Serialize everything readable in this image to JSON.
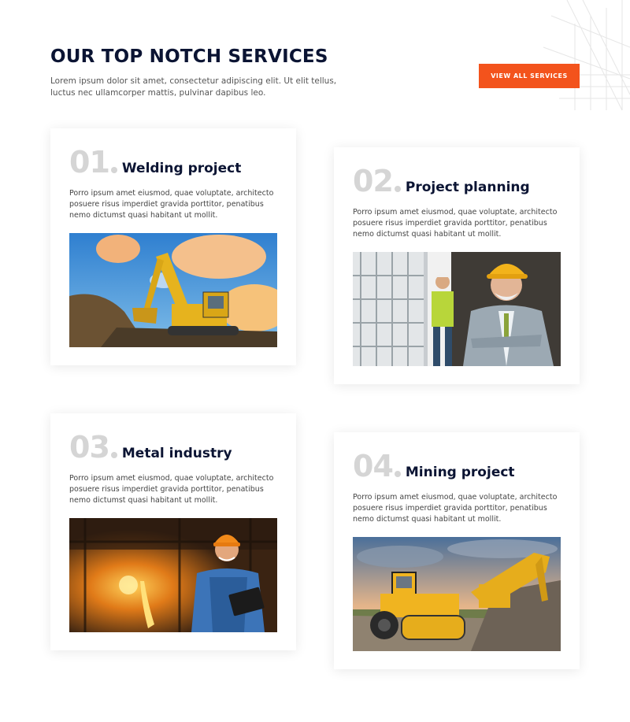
{
  "header": {
    "title": "OUR TOP NOTCH SERVICES",
    "intro": "Lorem ipsum dolor sit amet, consectetur adipiscing elit. Ut elit tellus, luctus nec ullamcorper mattis, pulvinar dapibus leo."
  },
  "actions": {
    "view_all_label": "VIEW ALL SERVICES"
  },
  "services": [
    {
      "number": "01",
      "title": "Welding project",
      "text": "Porro ipsum amet eiusmod, quae voluptate, architecto posuere risus imperdiet gravida porttitor, penatibus nemo dictumst quasi habitant ut mollit."
    },
    {
      "number": "02",
      "title": "Project planning",
      "text": "Porro ipsum amet eiusmod, quae voluptate, architecto posuere risus imperdiet gravida porttitor, penatibus nemo dictumst quasi habitant ut mollit."
    },
    {
      "number": "03",
      "title": "Metal industry",
      "text": "Porro ipsum amet eiusmod, quae voluptate, architecto posuere risus imperdiet gravida porttitor, penatibus nemo dictumst quasi habitant ut mollit."
    },
    {
      "number": "04",
      "title": "Mining project",
      "text": "Porro ipsum amet eiusmod, quae voluptate, architecto posuere risus imperdiet gravida porttitor, penatibus nemo dictumst quasi habitant ut mollit."
    }
  ],
  "colors": {
    "accent": "#f3531c",
    "heading": "#0b1433",
    "number": "#d5d5d5"
  }
}
